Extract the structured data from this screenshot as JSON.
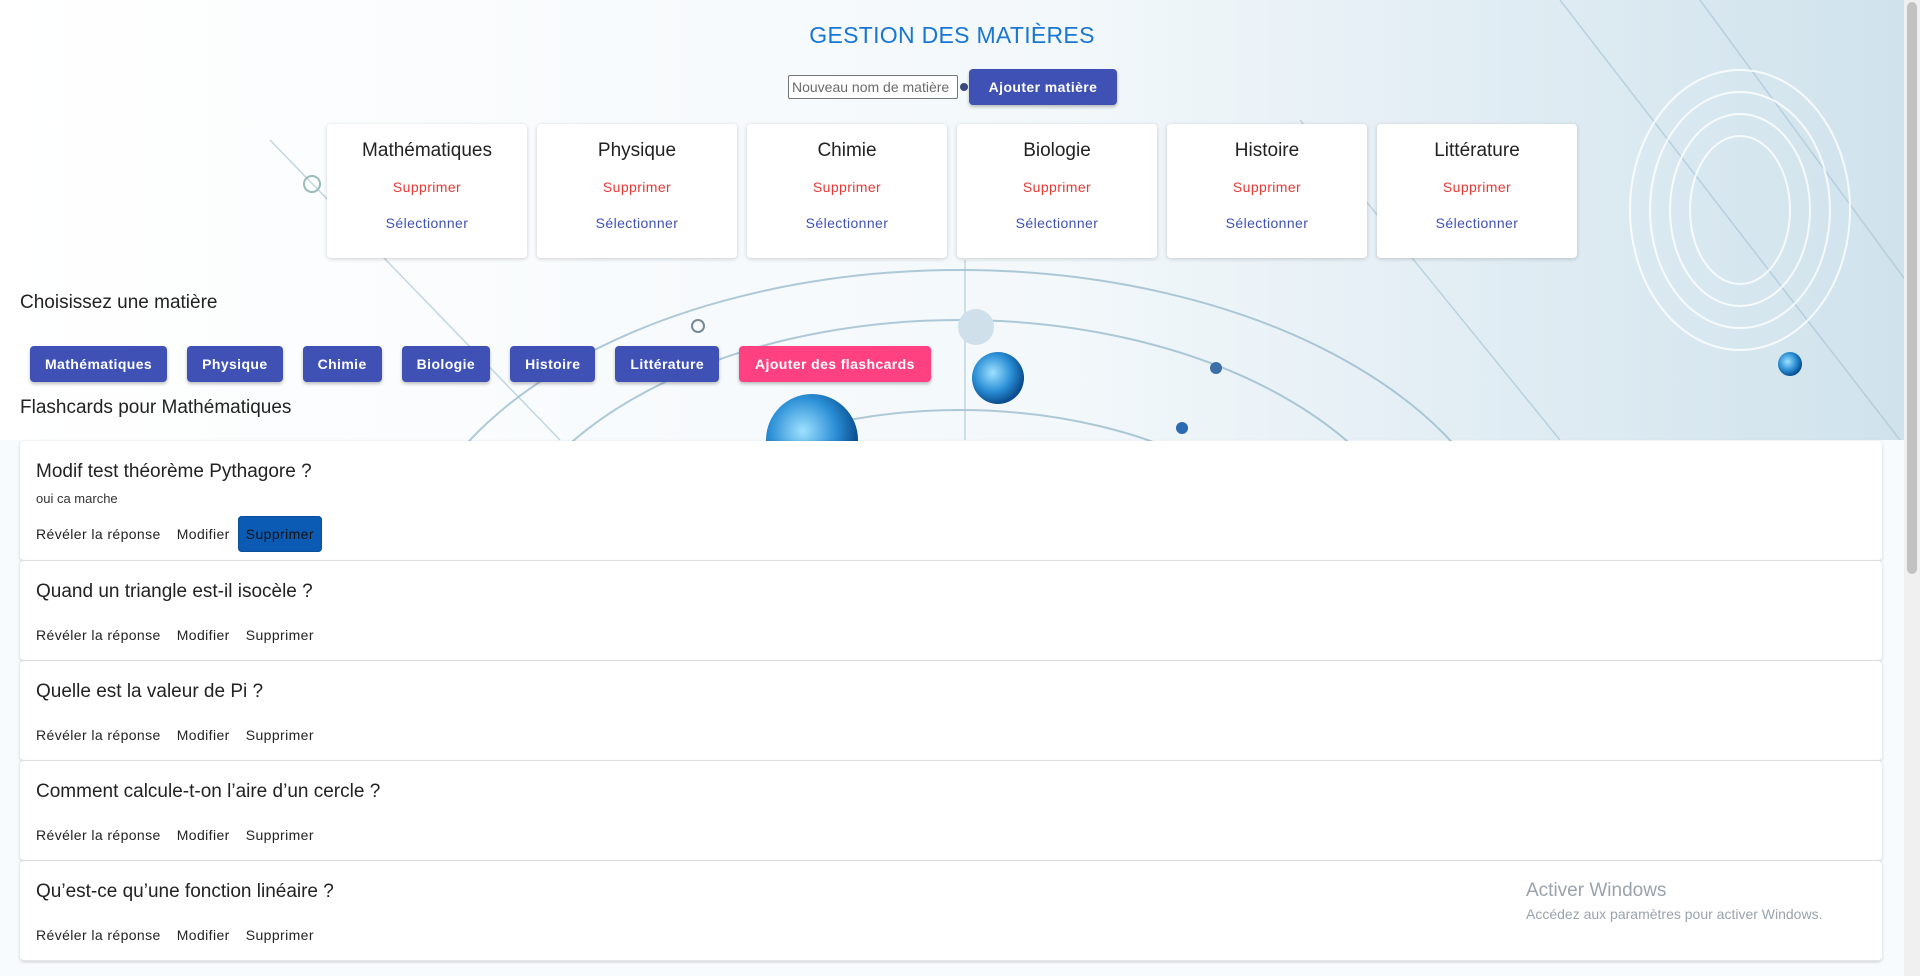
{
  "header": {
    "title": "GESTION DES MATIÈRES",
    "input_placeholder": "Nouveau nom de matière",
    "add_button": "Ajouter matière"
  },
  "subject_cards": [
    {
      "name": "Mathématiques",
      "delete": "Supprimer",
      "select": "Sélectionner"
    },
    {
      "name": "Physique",
      "delete": "Supprimer",
      "select": "Sélectionner"
    },
    {
      "name": "Chimie",
      "delete": "Supprimer",
      "select": "Sélectionner"
    },
    {
      "name": "Biologie",
      "delete": "Supprimer",
      "select": "Sélectionner"
    },
    {
      "name": "Histoire",
      "delete": "Supprimer",
      "select": "Sélectionner"
    },
    {
      "name": "Littérature",
      "delete": "Supprimer",
      "select": "Sélectionner"
    }
  ],
  "chooser": {
    "title": "Choisissez une matière",
    "subjects": [
      "Mathématiques",
      "Physique",
      "Chimie",
      "Biologie",
      "Histoire",
      "Littérature"
    ],
    "add_flashcards": "Ajouter des flashcards"
  },
  "flashcards_section": {
    "title": "Flashcards pour Mathématiques",
    "actions": {
      "reveal": "Révéler la réponse",
      "edit": "Modifier",
      "delete": "Supprimer"
    },
    "cards": [
      {
        "question": "Modif test théorème Pythagore ?",
        "answer": "oui ca marche"
      },
      {
        "question": "Quand un triangle est-il isocèle ?",
        "answer": ""
      },
      {
        "question": "Quelle est la valeur de Pi ?",
        "answer": ""
      },
      {
        "question": "Comment calcule-t-on l’aire d’un cercle ?",
        "answer": ""
      },
      {
        "question": "Qu’est-ce qu’une fonction linéaire ?",
        "answer": ""
      }
    ]
  },
  "watermark": {
    "line1": "Activer Windows",
    "line2": "Accédez aux paramètres pour activer Windows."
  },
  "colors": {
    "primary": "#3f51b5",
    "accent": "#ff4081",
    "danger": "#e53935",
    "title": "#1976d2"
  }
}
